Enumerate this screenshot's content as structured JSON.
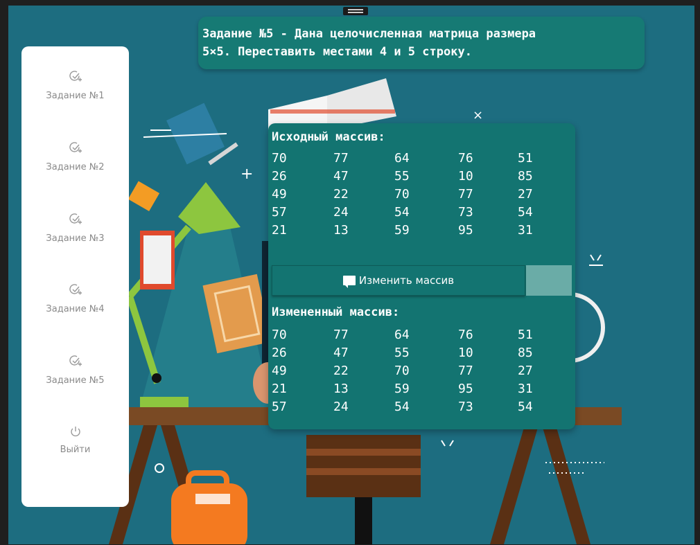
{
  "task": {
    "title_line1": "Задание №5 - Дана целочисленная матрица размера",
    "title_line2": "5×5. Переставить местами 4 и 5 строку."
  },
  "sidebar": {
    "items": [
      {
        "label": "Задание №1",
        "icon": "check-plus-icon"
      },
      {
        "label": "Задание №2",
        "icon": "check-plus-icon"
      },
      {
        "label": "Задание №3",
        "icon": "check-plus-icon"
      },
      {
        "label": "Задание №4",
        "icon": "check-plus-icon"
      },
      {
        "label": "Задание №5",
        "icon": "check-plus-icon"
      }
    ],
    "logout": {
      "label": "Выйти",
      "icon": "power-icon"
    }
  },
  "panel": {
    "source_title": "Исходный массив:",
    "result_title": "Измененный массив:",
    "button_label": "Изменить массив",
    "source": [
      [
        "70",
        "77",
        "64",
        "76",
        "51"
      ],
      [
        "26",
        "47",
        "55",
        "10",
        "85"
      ],
      [
        "49",
        "22",
        "70",
        "77",
        "27"
      ],
      [
        "57",
        "24",
        "54",
        "73",
        "54"
      ],
      [
        "21",
        "13",
        "59",
        "95",
        "31"
      ]
    ],
    "result": [
      [
        "70",
        "77",
        "64",
        "76",
        "51"
      ],
      [
        "26",
        "47",
        "55",
        "10",
        "85"
      ],
      [
        "49",
        "22",
        "70",
        "77",
        "27"
      ],
      [
        "21",
        "13",
        "59",
        "95",
        "31"
      ],
      [
        "57",
        "24",
        "54",
        "73",
        "54"
      ]
    ]
  },
  "colors": {
    "background": "#1d6d80",
    "panel": "#137471",
    "sidebar": "#ffffff",
    "accent_button": "#6aaca7"
  }
}
